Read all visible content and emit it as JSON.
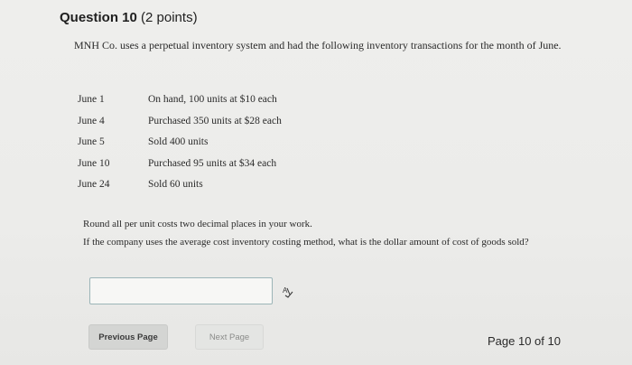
{
  "question": {
    "number_label": "Question 10",
    "points_label": "(2 points)",
    "text": "MNH Co. uses a perpetual inventory system and had the following inventory transactions for the month of June."
  },
  "transactions": [
    {
      "date": "June 1",
      "description": "On hand, 100 units at $10 each"
    },
    {
      "date": "June 4",
      "description": "Purchased 350 units at $28 each"
    },
    {
      "date": "June 5",
      "description": "Sold 400 units"
    },
    {
      "date": "June 10",
      "description": "Purchased 95 units at $34 each"
    },
    {
      "date": "June 24",
      "description": "Sold 60 units"
    }
  ],
  "instructions": {
    "rounding": "Round all per unit costs two decimal places in your work.",
    "prompt": "If the company uses the average cost inventory costing method, what is the dollar amount of cost of goods sold?"
  },
  "answer": {
    "value": "",
    "placeholder": ""
  },
  "icons": {
    "spellcheck": "spellcheck-icon"
  },
  "navigation": {
    "previous_label": "Previous Page",
    "next_label": "Next Page",
    "page_indicator": "Page 10 of 10"
  }
}
